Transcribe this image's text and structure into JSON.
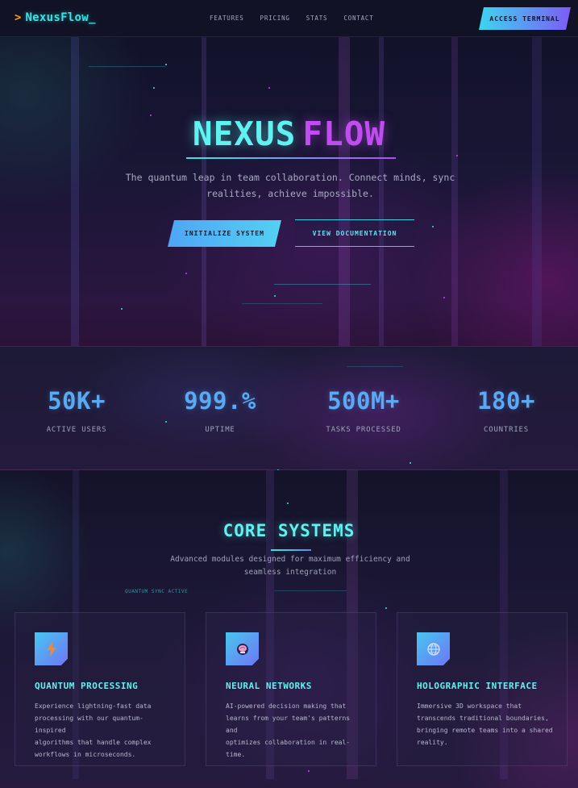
{
  "nav": {
    "logo_prefix": ">",
    "logo_text": "NexusFlow_",
    "links": [
      "FEATURES",
      "PRICING",
      "STATS",
      "CONTACT"
    ],
    "access_button": "ACCESS TERMINAL"
  },
  "hero": {
    "title_part1": "NEXUS",
    "title_part2": "FLOW",
    "subtitle_line1": "The quantum leap in team collaboration. Connect minds, sync",
    "subtitle_line2": "realities, achieve impossible.",
    "primary_button": "INITIALIZE SYSTEM",
    "secondary_button": "VIEW DOCUMENTATION"
  },
  "stats": [
    {
      "value": "50K+",
      "label": "ACTIVE USERS"
    },
    {
      "value": "999.%",
      "label": "UPTIME"
    },
    {
      "value": "500M+",
      "label": "TASKS PROCESSED"
    },
    {
      "value": "180+",
      "label": "COUNTRIES"
    }
  ],
  "features": {
    "title": "CORE SYSTEMS",
    "subtitle_line1": "Advanced modules designed for maximum efficiency and",
    "subtitle_line2": "seamless integration",
    "sync_label": "QUANTUM SYNC ACTIVE",
    "cards": [
      {
        "icon": "lightning-icon",
        "title": "QUANTUM PROCESSING",
        "lines": [
          "Experience lightning-fast data",
          "processing with our quantum-inspired",
          "algorithms that handle complex",
          "workflows in microseconds."
        ]
      },
      {
        "icon": "brain-icon",
        "title": "NEURAL NETWORKS",
        "lines": [
          "AI-powered decision making that",
          "learns from your team's patterns and",
          "optimizes collaboration in real-",
          "time."
        ]
      },
      {
        "icon": "globe-icon",
        "title": "HOLOGRAPHIC INTERFACE",
        "lines": [
          "Immersive 3D workspace that",
          "transcends traditional boundaries,",
          "bringing remote teams into a shared",
          "reality."
        ]
      }
    ]
  },
  "colors": {
    "accent_cyan": "#5ff2f0",
    "accent_magenta": "#c14cf0",
    "stat_blue": "#5aa9f3",
    "logo_chevron": "#f59e0b"
  }
}
